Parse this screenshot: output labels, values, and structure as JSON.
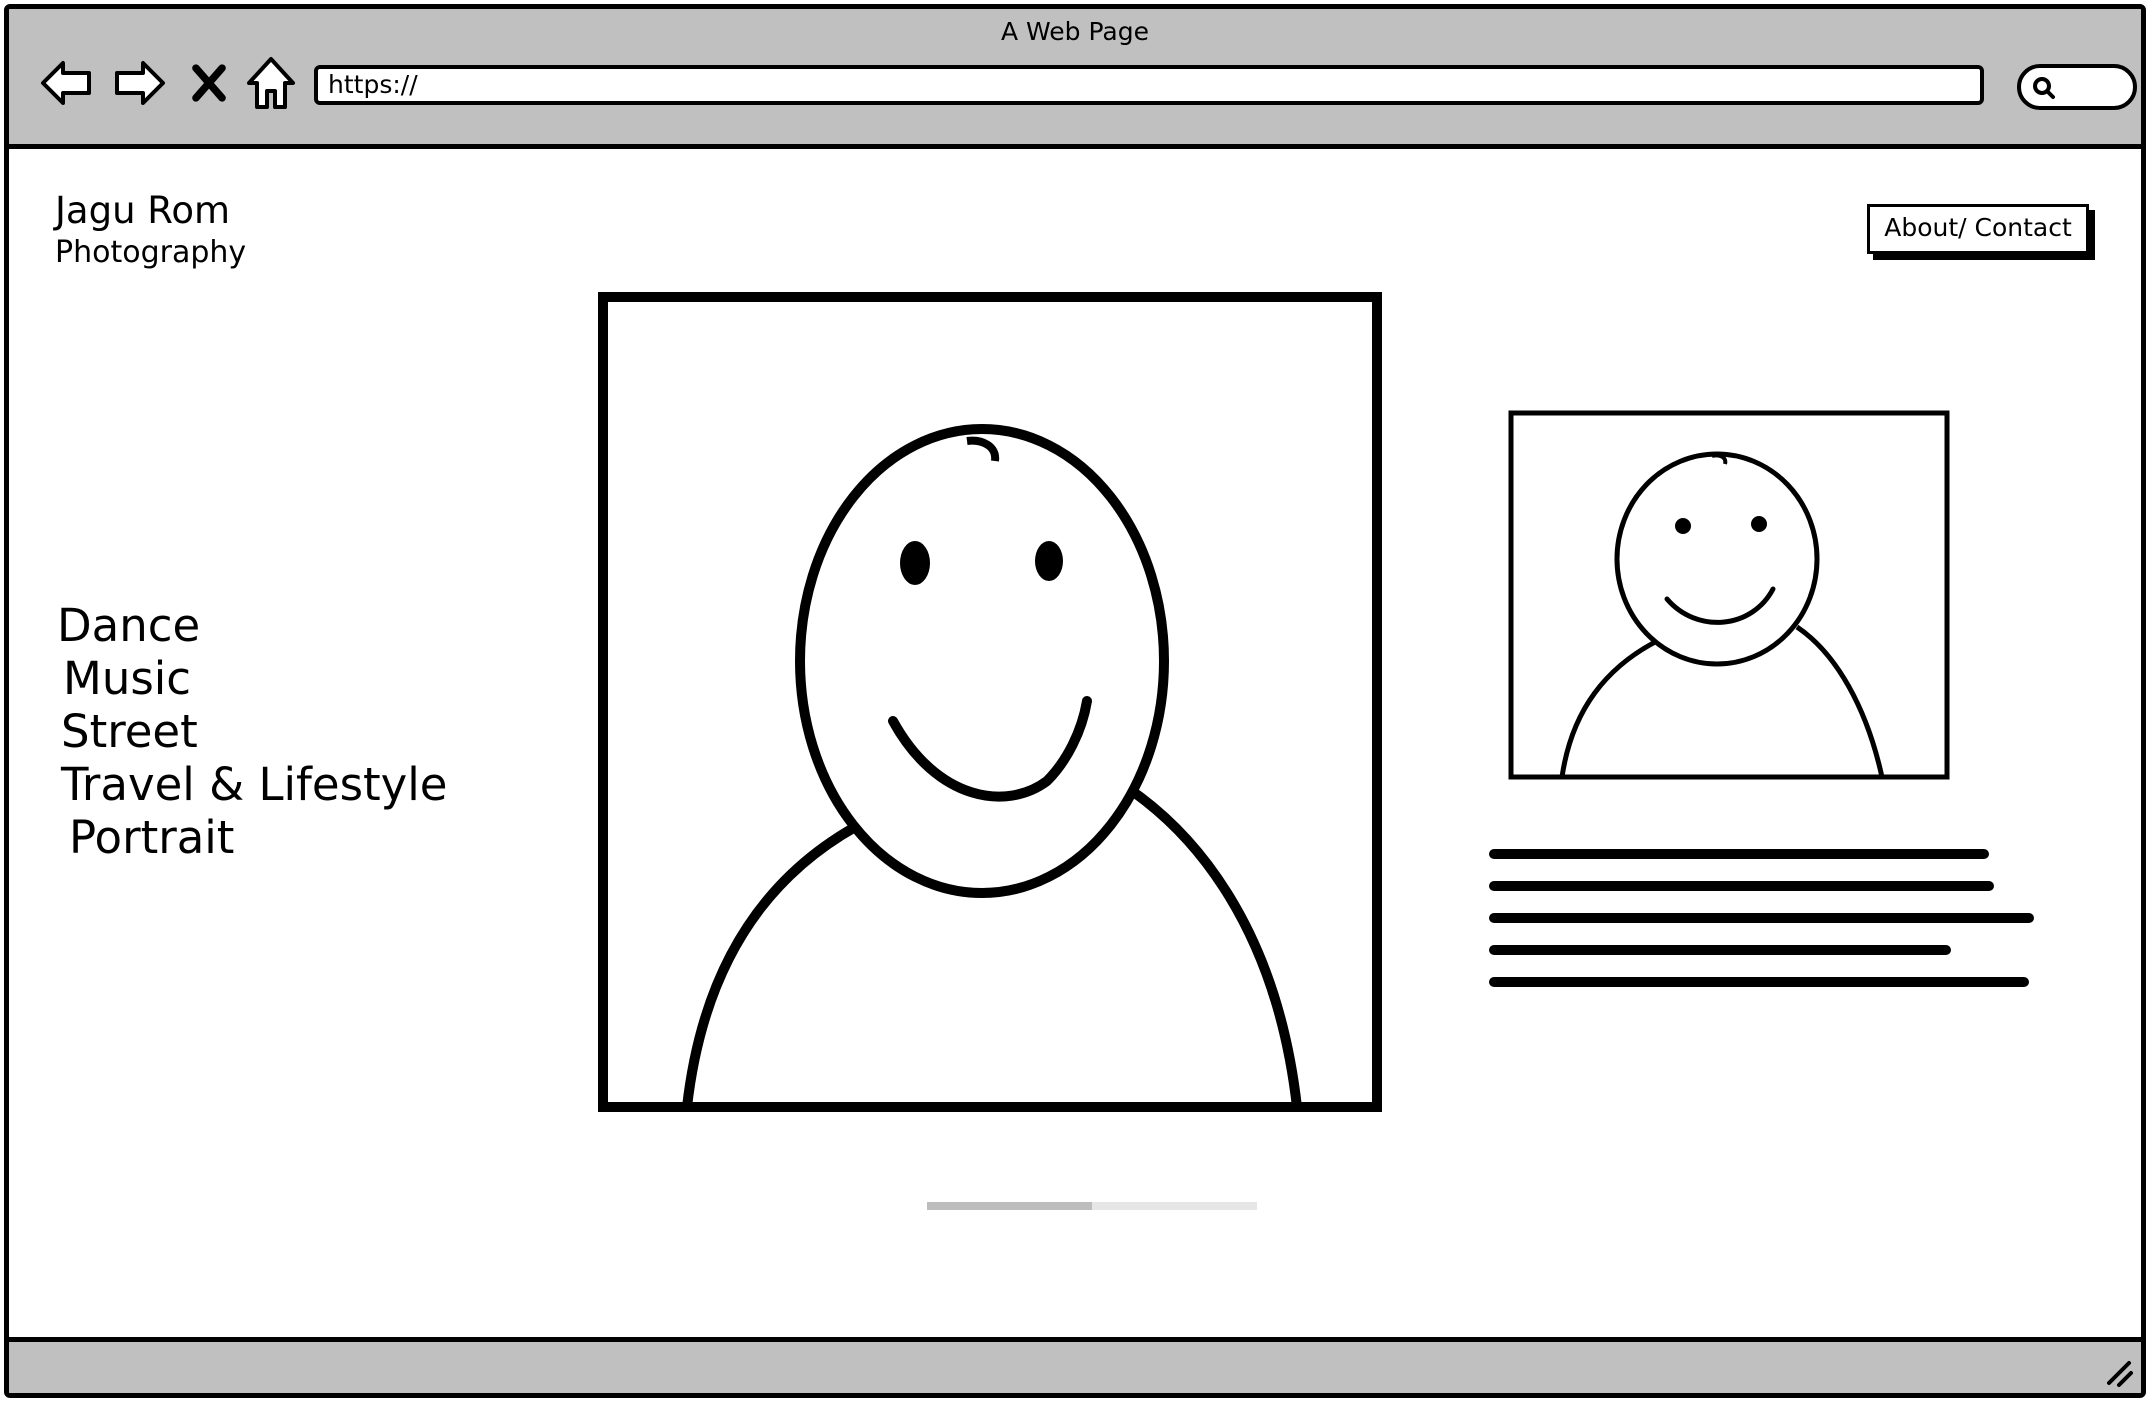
{
  "window": {
    "title": "A Web Page"
  },
  "browser": {
    "url": "https://",
    "icons": [
      "back-arrow-icon",
      "forward-arrow-icon",
      "stop-x-icon",
      "home-icon",
      "search-icon"
    ]
  },
  "header": {
    "brand_name": "Jagu Rom",
    "brand_sub": "Photography",
    "about_label": "About/ Contact"
  },
  "categories": [
    "Dance",
    "Music",
    "Street",
    "Travel & Lifestyle",
    "Portrait"
  ],
  "gallery": {
    "main_image": "smiley-person-placeholder",
    "side_image": "smiley-person-placeholder",
    "progress": 0.5
  },
  "colors": {
    "chrome": "#c0c0c0",
    "ink": "#000000",
    "progress_track": "#e6e6e6",
    "progress_fill": "#bdbdbd"
  }
}
